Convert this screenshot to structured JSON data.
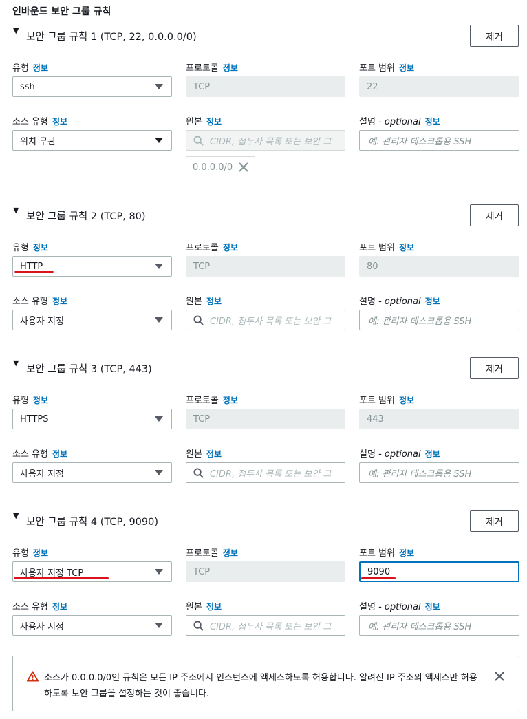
{
  "section_title": "인바운드 보안 그룹 규칙",
  "labels": {
    "type": "유형",
    "protocol": "프로토콜",
    "port_range": "포트 범위",
    "source_type": "소스 유형",
    "source": "원본",
    "description": "설명",
    "optional": "- optional",
    "info": "정보"
  },
  "remove_label": "제거",
  "source_placeholder": "CIDR, 접두사 목록 또는 보안 그",
  "description_placeholder": "예: 관리자 데스크톱용 SSH",
  "rules": [
    {
      "title": "보안 그룹 규칙 1 (TCP, 22, 0.0.0.0/0)",
      "type": "ssh",
      "protocol": "TCP",
      "port": "22",
      "source_type": "위치 무관",
      "source_token": "0.0.0.0/0"
    },
    {
      "title": "보안 그룹 규칙 2 (TCP, 80)",
      "type": "HTTP",
      "protocol": "TCP",
      "port": "80",
      "source_type": "사용자 지정"
    },
    {
      "title": "보안 그룹 규칙 3 (TCP, 443)",
      "type": "HTTPS",
      "protocol": "TCP",
      "port": "443",
      "source_type": "사용자 지정"
    },
    {
      "title": "보안 그룹 규칙 4 (TCP, 9090)",
      "type": "사용자 지정 TCP",
      "protocol": "TCP",
      "port": "9090",
      "source_type": "사용자 지정"
    }
  ],
  "alert": {
    "text": "소스가 0.0.0.0/0인 규칙은 모든 IP 주소에서 인스턴스에 액세스하도록 허용합니다. 알려진 IP 주소의 액세스만 허용하도록 보안 그룹을 설정하는 것이 좋습니다.",
    "icon": "warning-icon",
    "color": "#d13212"
  },
  "colors": {
    "info_link": "#0073bb",
    "annotation_underline": "#d9141d",
    "focus": "#0073bb"
  }
}
